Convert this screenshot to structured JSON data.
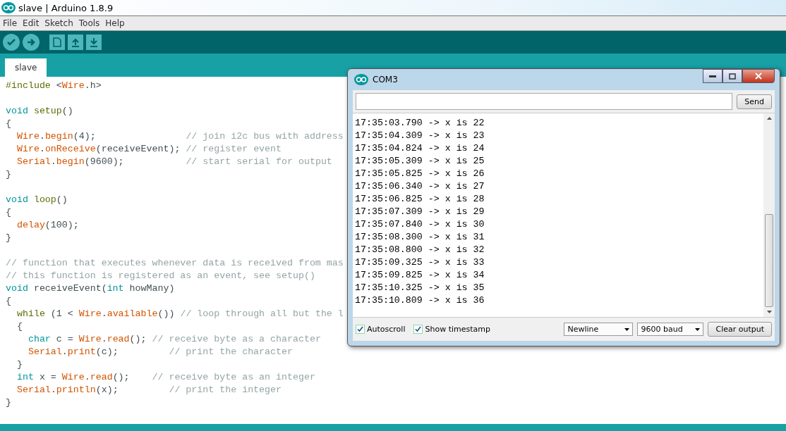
{
  "window": {
    "title": "slave | Arduino 1.8.9"
  },
  "menu": [
    "File",
    "Edit",
    "Sketch",
    "Tools",
    "Help"
  ],
  "toolbar": [
    {
      "kind": "verify"
    },
    {
      "kind": "upload"
    },
    {
      "kind": "new"
    },
    {
      "kind": "open"
    },
    {
      "kind": "save"
    }
  ],
  "tabs": [
    {
      "label": "slave",
      "selected": true
    }
  ],
  "code": [
    {
      "kind": "code",
      "tokens": [
        {
          "t": "#include ",
          "kind": "pre"
        },
        {
          "t": "<",
          "kind": "tx"
        },
        {
          "t": "Wire",
          "kind": "fn"
        },
        {
          "t": ".h>",
          "kind": "tx"
        }
      ]
    },
    {
      "kind": "blank"
    },
    {
      "kind": "code",
      "tokens": [
        {
          "t": "void",
          "kind": "kw"
        },
        {
          "t": " setup",
          "kind": "pre"
        },
        {
          "t": "()",
          "kind": "tx"
        }
      ]
    },
    {
      "kind": "code",
      "tokens": [
        {
          "t": "{",
          "kind": "tx"
        }
      ]
    },
    {
      "kind": "code",
      "tokens": [
        {
          "t": "  Wire",
          "kind": "fn"
        },
        {
          "t": ".",
          "kind": "tx"
        },
        {
          "t": "begin",
          "kind": "fn"
        },
        {
          "t": "(4);                ",
          "kind": "tx"
        },
        {
          "t": "// join i2c bus with address",
          "kind": "cm"
        }
      ]
    },
    {
      "kind": "code",
      "tokens": [
        {
          "t": "  Wire",
          "kind": "fn"
        },
        {
          "t": ".",
          "kind": "tx"
        },
        {
          "t": "onReceive",
          "kind": "fn"
        },
        {
          "t": "(receiveEvent); ",
          "kind": "tx"
        },
        {
          "t": "// register event",
          "kind": "cm"
        }
      ]
    },
    {
      "kind": "code",
      "tokens": [
        {
          "t": "  Serial",
          "kind": "fn"
        },
        {
          "t": ".",
          "kind": "tx"
        },
        {
          "t": "begin",
          "kind": "fn"
        },
        {
          "t": "(9600);           ",
          "kind": "tx"
        },
        {
          "t": "// start serial for output",
          "kind": "cm"
        }
      ]
    },
    {
      "kind": "code",
      "tokens": [
        {
          "t": "}",
          "kind": "tx"
        }
      ]
    },
    {
      "kind": "blank"
    },
    {
      "kind": "code",
      "tokens": [
        {
          "t": "void",
          "kind": "kw"
        },
        {
          "t": " loop",
          "kind": "pre"
        },
        {
          "t": "()",
          "kind": "tx"
        }
      ]
    },
    {
      "kind": "code",
      "tokens": [
        {
          "t": "{",
          "kind": "tx"
        }
      ]
    },
    {
      "kind": "code",
      "tokens": [
        {
          "t": "  delay",
          "kind": "fn"
        },
        {
          "t": "(100);",
          "kind": "tx"
        }
      ]
    },
    {
      "kind": "code",
      "tokens": [
        {
          "t": "}",
          "kind": "tx"
        }
      ]
    },
    {
      "kind": "blank"
    },
    {
      "kind": "code",
      "tokens": [
        {
          "t": "// function that executes whenever data is received from mas",
          "kind": "cm"
        }
      ]
    },
    {
      "kind": "code",
      "tokens": [
        {
          "t": "// this function is registered as an event, see setup()",
          "kind": "cm"
        }
      ]
    },
    {
      "kind": "code",
      "tokens": [
        {
          "t": "void",
          "kind": "kw"
        },
        {
          "t": " receiveEvent(",
          "kind": "tx"
        },
        {
          "t": "int",
          "kind": "kw"
        },
        {
          "t": " howMany)",
          "kind": "tx"
        }
      ]
    },
    {
      "kind": "code",
      "tokens": [
        {
          "t": "{",
          "kind": "tx"
        }
      ]
    },
    {
      "kind": "code",
      "tokens": [
        {
          "t": "  while",
          "kind": "pre"
        },
        {
          "t": " (1 < ",
          "kind": "tx"
        },
        {
          "t": "Wire",
          "kind": "fn"
        },
        {
          "t": ".",
          "kind": "tx"
        },
        {
          "t": "available",
          "kind": "fn"
        },
        {
          "t": "()) ",
          "kind": "tx"
        },
        {
          "t": "// loop through all but the l",
          "kind": "cm"
        }
      ]
    },
    {
      "kind": "code",
      "tokens": [
        {
          "t": "  {",
          "kind": "tx"
        }
      ]
    },
    {
      "kind": "code",
      "tokens": [
        {
          "t": "    char",
          "kind": "kw"
        },
        {
          "t": " c = ",
          "kind": "tx"
        },
        {
          "t": "Wire",
          "kind": "fn"
        },
        {
          "t": ".",
          "kind": "tx"
        },
        {
          "t": "read",
          "kind": "fn"
        },
        {
          "t": "(); ",
          "kind": "tx"
        },
        {
          "t": "// receive byte as a character",
          "kind": "cm"
        }
      ]
    },
    {
      "kind": "code",
      "tokens": [
        {
          "t": "    Serial",
          "kind": "fn"
        },
        {
          "t": ".",
          "kind": "tx"
        },
        {
          "t": "print",
          "kind": "fn"
        },
        {
          "t": "(c);         ",
          "kind": "tx"
        },
        {
          "t": "// print the character",
          "kind": "cm"
        }
      ]
    },
    {
      "kind": "code",
      "tokens": [
        {
          "t": "  }",
          "kind": "tx"
        }
      ]
    },
    {
      "kind": "code",
      "tokens": [
        {
          "t": "  int",
          "kind": "kw"
        },
        {
          "t": " x = ",
          "kind": "tx"
        },
        {
          "t": "Wire",
          "kind": "fn"
        },
        {
          "t": ".",
          "kind": "tx"
        },
        {
          "t": "read",
          "kind": "fn"
        },
        {
          "t": "();    ",
          "kind": "tx"
        },
        {
          "t": "// receive byte as an integer",
          "kind": "cm"
        }
      ]
    },
    {
      "kind": "code",
      "tokens": [
        {
          "t": "  Serial",
          "kind": "fn"
        },
        {
          "t": ".",
          "kind": "tx"
        },
        {
          "t": "println",
          "kind": "fn"
        },
        {
          "t": "(x);         ",
          "kind": "tx"
        },
        {
          "t": "// print the integer",
          "kind": "cm"
        }
      ]
    },
    {
      "kind": "code",
      "tokens": [
        {
          "t": "}",
          "kind": "tx"
        }
      ]
    }
  ],
  "serial_monitor": {
    "title": "COM3",
    "send_button": "Send",
    "output": [
      "17:35:03.790 -> x is 22",
      "17:35:04.309 -> x is 23",
      "17:35:04.824 -> x is 24",
      "17:35:05.309 -> x is 25",
      "17:35:05.825 -> x is 26",
      "17:35:06.340 -> x is 27",
      "17:35:06.825 -> x is 28",
      "17:35:07.309 -> x is 29",
      "17:35:07.840 -> x is 30",
      "17:35:08.300 -> x is 31",
      "17:35:08.800 -> x is 32",
      "17:35:09.325 -> x is 33",
      "17:35:09.825 -> x is 34",
      "17:35:10.325 -> x is 35",
      "17:35:10.809 -> x is 36"
    ],
    "options": [
      {
        "label": "Autoscroll",
        "checked": true
      },
      {
        "label": "Show timestamp",
        "checked": true
      }
    ],
    "line_ending": "Newline",
    "baud": "9600 baud",
    "clear_button": "Clear output"
  }
}
